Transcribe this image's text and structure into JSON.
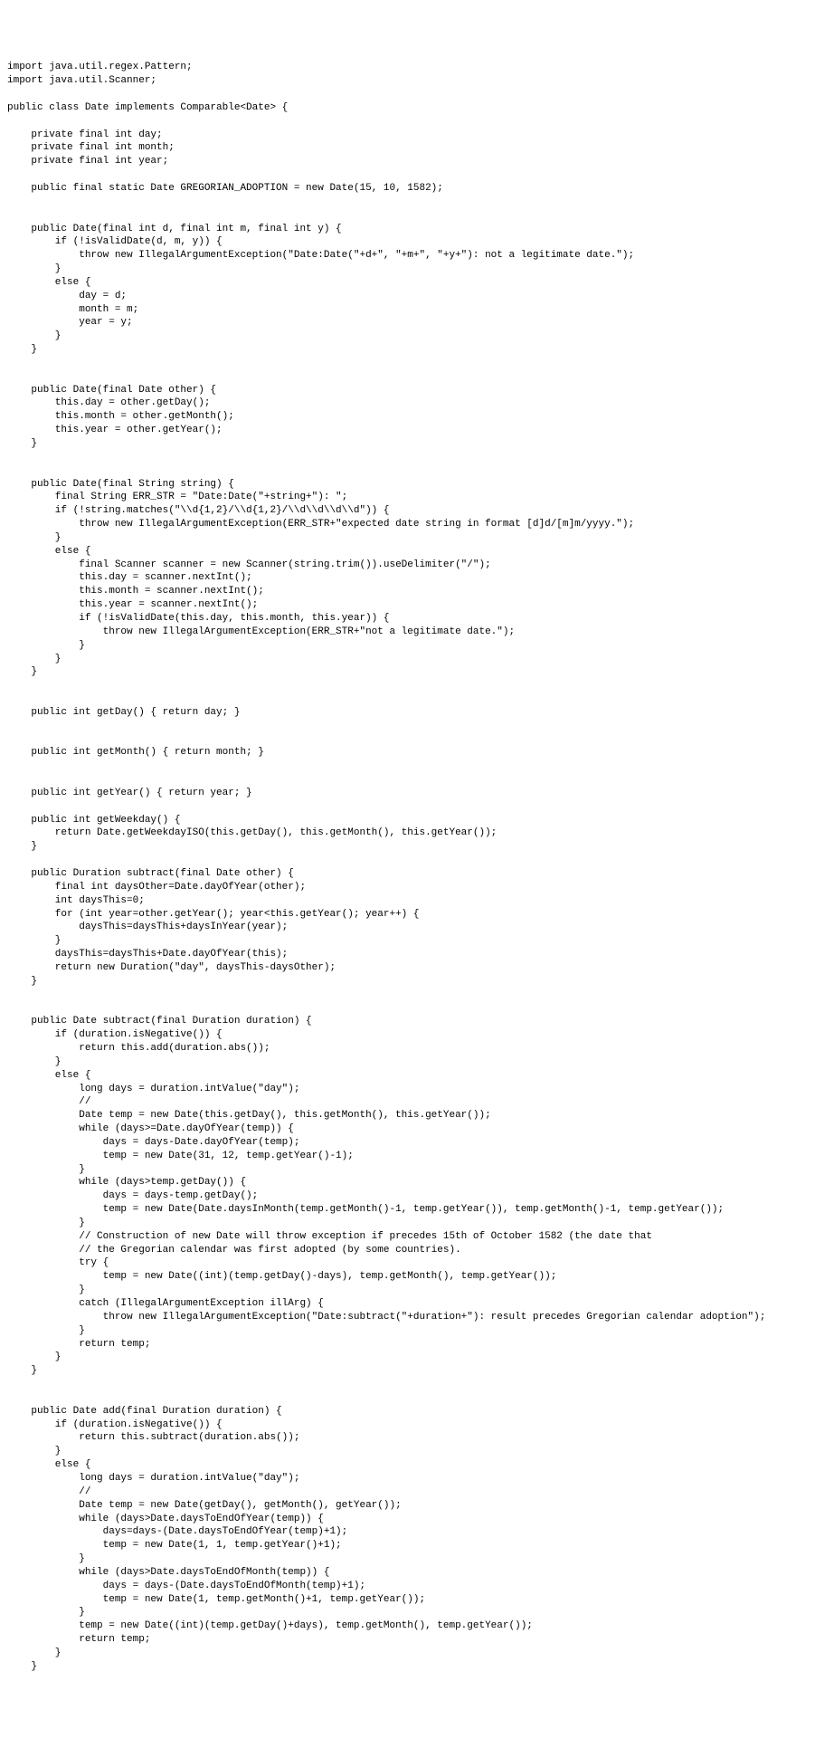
{
  "code_lines": [
    "import java.util.regex.Pattern;",
    "import java.util.Scanner;",
    "",
    "public class Date implements Comparable<Date> {",
    "",
    "    private final int day;",
    "    private final int month;",
    "    private final int year;",
    "",
    "    public final static Date GREGORIAN_ADOPTION = new Date(15, 10, 1582);",
    "",
    "",
    "    public Date(final int d, final int m, final int y) {",
    "        if (!isValidDate(d, m, y)) {",
    "            throw new IllegalArgumentException(\"Date:Date(\"+d+\", \"+m+\", \"+y+\"): not a legitimate date.\");",
    "        }",
    "        else {",
    "            day = d;",
    "            month = m;",
    "            year = y;",
    "        }",
    "    }",
    "",
    "",
    "    public Date(final Date other) {",
    "        this.day = other.getDay();",
    "        this.month = other.getMonth();",
    "        this.year = other.getYear();",
    "    }",
    "",
    "",
    "    public Date(final String string) {",
    "        final String ERR_STR = \"Date:Date(\"+string+\"): \";",
    "        if (!string.matches(\"\\\\d{1,2}/\\\\d{1,2}/\\\\d\\\\d\\\\d\\\\d\")) {",
    "            throw new IllegalArgumentException(ERR_STR+\"expected date string in format [d]d/[m]m/yyyy.\");",
    "        }",
    "        else {",
    "            final Scanner scanner = new Scanner(string.trim()).useDelimiter(\"/\");",
    "            this.day = scanner.nextInt();",
    "            this.month = scanner.nextInt();",
    "            this.year = scanner.nextInt();",
    "            if (!isValidDate(this.day, this.month, this.year)) {",
    "                throw new IllegalArgumentException(ERR_STR+\"not a legitimate date.\");",
    "            }",
    "        }",
    "    }",
    "",
    "",
    "    public int getDay() { return day; }",
    "",
    "",
    "    public int getMonth() { return month; }",
    "",
    "",
    "    public int getYear() { return year; }",
    "",
    "    public int getWeekday() {",
    "        return Date.getWeekdayISO(this.getDay(), this.getMonth(), this.getYear());",
    "    }",
    "",
    "    public Duration subtract(final Date other) {",
    "        final int daysOther=Date.dayOfYear(other);",
    "        int daysThis=0;",
    "        for (int year=other.getYear(); year<this.getYear(); year++) {",
    "            daysThis=daysThis+daysInYear(year);",
    "        }",
    "        daysThis=daysThis+Date.dayOfYear(this);",
    "        return new Duration(\"day\", daysThis-daysOther);",
    "    }",
    "",
    "",
    "    public Date subtract(final Duration duration) {",
    "        if (duration.isNegative()) {",
    "            return this.add(duration.abs());",
    "        }",
    "        else {",
    "            long days = duration.intValue(\"day\");",
    "            //",
    "            Date temp = new Date(this.getDay(), this.getMonth(), this.getYear());",
    "            while (days>=Date.dayOfYear(temp)) {",
    "                days = days-Date.dayOfYear(temp);",
    "                temp = new Date(31, 12, temp.getYear()-1);",
    "            }",
    "            while (days>temp.getDay()) {",
    "                days = days-temp.getDay();",
    "                temp = new Date(Date.daysInMonth(temp.getMonth()-1, temp.getYear()), temp.getMonth()-1, temp.getYear());",
    "            }",
    "            // Construction of new Date will throw exception if precedes 15th of October 1582 (the date that",
    "            // the Gregorian calendar was first adopted (by some countries).",
    "            try {",
    "                temp = new Date((int)(temp.getDay()-days), temp.getMonth(), temp.getYear());",
    "            }",
    "            catch (IllegalArgumentException illArg) {",
    "                throw new IllegalArgumentException(\"Date:subtract(\"+duration+\"): result precedes Gregorian calendar adoption\");",
    "            }",
    "            return temp;",
    "        }",
    "    }",
    "",
    "",
    "    public Date add(final Duration duration) {",
    "        if (duration.isNegative()) {",
    "            return this.subtract(duration.abs());",
    "        }",
    "        else {",
    "            long days = duration.intValue(\"day\");",
    "            //",
    "            Date temp = new Date(getDay(), getMonth(), getYear());",
    "            while (days>Date.daysToEndOfYear(temp)) {",
    "                days=days-(Date.daysToEndOfYear(temp)+1);",
    "                temp = new Date(1, 1, temp.getYear()+1);",
    "            }",
    "            while (days>Date.daysToEndOfMonth(temp)) {",
    "                days = days-(Date.daysToEndOfMonth(temp)+1);",
    "                temp = new Date(1, temp.getMonth()+1, temp.getYear());",
    "            }",
    "            temp = new Date((int)(temp.getDay()+days), temp.getMonth(), temp.getYear());",
    "            return temp;",
    "        }",
    "    }"
  ]
}
